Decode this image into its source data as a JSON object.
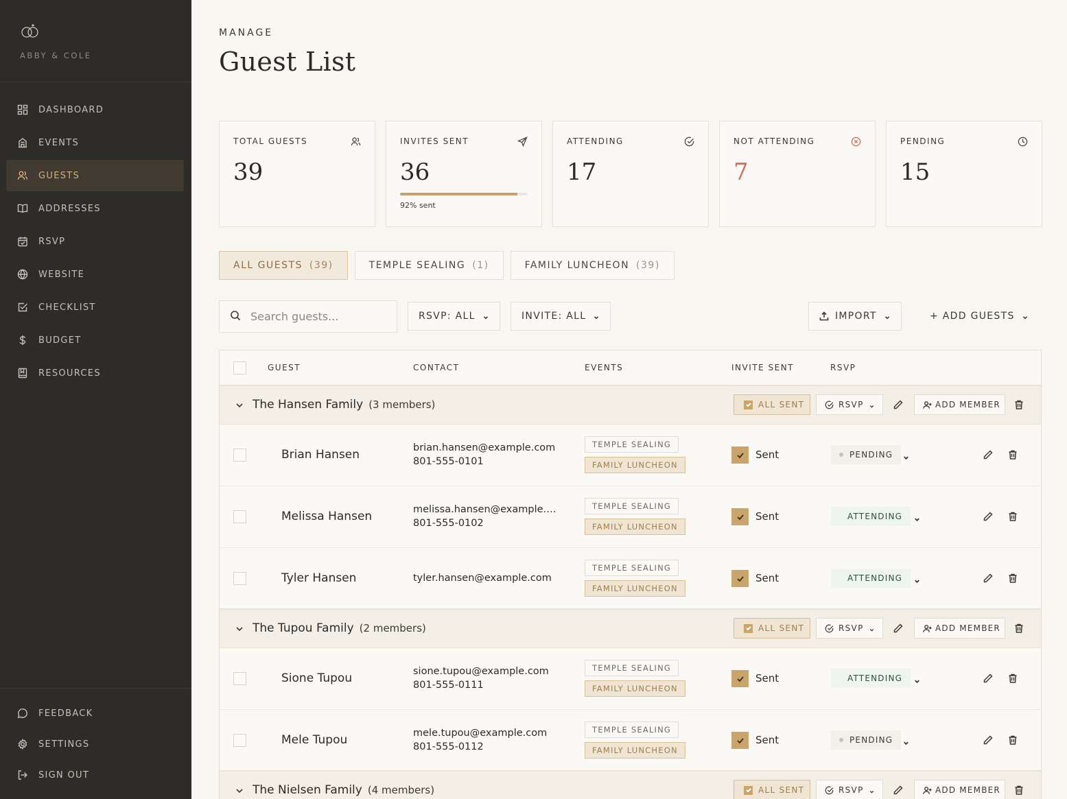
{
  "brand": {
    "name": "ABBY & COLE"
  },
  "nav": {
    "items": [
      {
        "label": "DASHBOARD",
        "icon": "dashboard-icon"
      },
      {
        "label": "EVENTS",
        "icon": "building-icon"
      },
      {
        "label": "GUESTS",
        "icon": "users-icon",
        "active": true
      },
      {
        "label": "ADDRESSES",
        "icon": "book-icon"
      },
      {
        "label": "RSVP",
        "icon": "calendar-check-icon"
      },
      {
        "label": "WEBSITE",
        "icon": "globe-icon"
      },
      {
        "label": "CHECKLIST",
        "icon": "checkbox-icon"
      },
      {
        "label": "BUDGET",
        "icon": "dollar-icon"
      },
      {
        "label": "RESOURCES",
        "icon": "bookmark-book-icon"
      }
    ],
    "bottom": [
      {
        "label": "FEEDBACK",
        "icon": "chat-icon"
      },
      {
        "label": "SETTINGS",
        "icon": "gear-icon"
      },
      {
        "label": "SIGN OUT",
        "icon": "sign-out-icon"
      }
    ]
  },
  "header": {
    "eyebrow": "MANAGE",
    "title": "Guest List"
  },
  "stats": {
    "total": {
      "label": "TOTAL GUESTS",
      "value": "39",
      "icon": "users-icon"
    },
    "sent": {
      "label": "INVITES SENT",
      "value": "36",
      "icon": "send-icon",
      "progress": 0.92,
      "sub": "92% sent"
    },
    "attending": {
      "label": "ATTENDING",
      "value": "17",
      "icon": "check-circle-icon"
    },
    "not_attending": {
      "label": "NOT ATTENDING",
      "value": "7",
      "icon": "x-circle-icon",
      "color": "#d26a59"
    },
    "pending": {
      "label": "PENDING",
      "value": "15",
      "icon": "clock-icon"
    }
  },
  "tabs": [
    {
      "label": "ALL GUESTS",
      "count": "(39)",
      "active": true
    },
    {
      "label": "TEMPLE SEALING",
      "count": "(1)"
    },
    {
      "label": "FAMILY LUNCHEON",
      "count": "(39)"
    }
  ],
  "toolbar": {
    "search_placeholder": "Search guests...",
    "rsvp_filter": "RSVP: ALL",
    "invite_filter": "INVITE: ALL",
    "import": "IMPORT",
    "add_guests": "+ ADD GUESTS"
  },
  "table": {
    "headers": {
      "guest": "GUEST",
      "contact": "CONTACT",
      "events": "EVENTS",
      "invite": "INVITE SENT",
      "rsvp": "RSVP"
    },
    "group_actions": {
      "all_sent": "ALL SENT",
      "rsvp": "RSVP",
      "add_member": "ADD MEMBER"
    },
    "sent_label": "Sent",
    "events": {
      "temple": "TEMPLE SEALING",
      "luncheon": "FAMILY LUNCHEON"
    },
    "groups": [
      {
        "name": "The Hansen Family",
        "count": "(3 members)",
        "members": [
          {
            "name": "Brian Hansen",
            "email": "brian.hansen@example.com",
            "phone": "801-555-0101",
            "rsvp": "PENDING"
          },
          {
            "name": "Melissa Hansen",
            "email": "melissa.hansen@example.c...",
            "phone": "801-555-0102",
            "rsvp": "ATTENDING"
          },
          {
            "name": "Tyler Hansen",
            "email": "tyler.hansen@example.com",
            "phone": "",
            "rsvp": "ATTENDING"
          }
        ]
      },
      {
        "name": "The Tupou Family",
        "count": "(2 members)",
        "members": [
          {
            "name": "Sione Tupou",
            "email": "sione.tupou@example.com",
            "phone": "801-555-0111",
            "rsvp": "ATTENDING"
          },
          {
            "name": "Mele Tupou",
            "email": "mele.tupou@example.com",
            "phone": "801-555-0112",
            "rsvp": "PENDING"
          }
        ]
      },
      {
        "name": "The Nielsen Family",
        "count": "(4 members)",
        "members": []
      }
    ]
  }
}
